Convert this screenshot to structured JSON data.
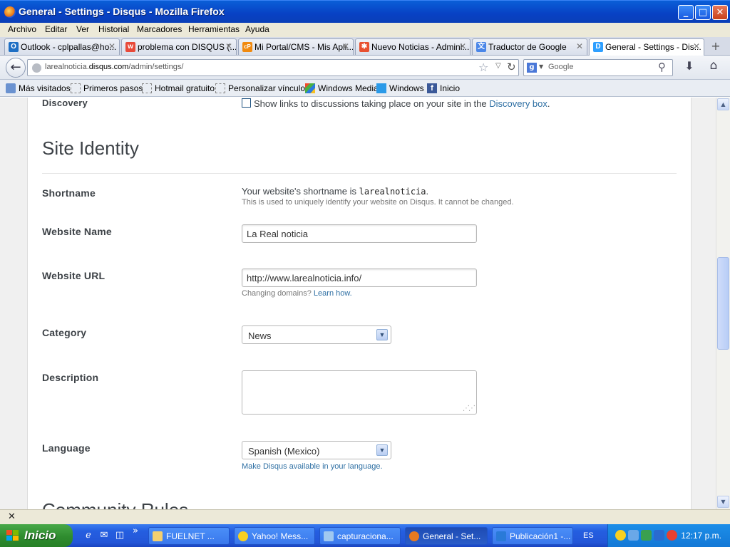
{
  "window": {
    "title": "General - Settings - Disqus - Mozilla Firefox",
    "minimize": "_",
    "maximize": "□",
    "close": "✕"
  },
  "menu": [
    "Archivo",
    "Editar",
    "Ver",
    "Historial",
    "Marcadores",
    "Herramientas",
    "Ayuda"
  ],
  "tabs": [
    {
      "label": "Outlook - cplpallas@ho...",
      "icon": "outlook-icon",
      "icon_color": "#1f6fc4",
      "icon_text": "O"
    },
    {
      "label": "problema con DISQUS (...",
      "icon": "blogger-icon",
      "icon_color": "#e84a3a",
      "icon_text": "w"
    },
    {
      "label": "Mi Portal/CMS - Mis Apli...",
      "icon": "cpanel-icon",
      "icon_color": "#f08a10",
      "icon_text": "cP"
    },
    {
      "label": "Nuevo Noticias - Admini...",
      "icon": "joomla-icon",
      "icon_color": "#e85030",
      "icon_text": "✱"
    },
    {
      "label": "Traductor de Google",
      "icon": "translate-icon",
      "icon_color": "#4a86e8",
      "icon_text": "文"
    },
    {
      "label": "General - Settings - Dis...",
      "icon": "disqus-icon",
      "icon_color": "#2e9fff",
      "icon_text": "D",
      "active": true
    }
  ],
  "tab_close": "✕",
  "new_tab": "+",
  "nav": {
    "url_host_pre": "larealnoticia.",
    "url_host": "disqus.com",
    "url_path": "/admin/settings/",
    "search_placeholder": "Google",
    "search_engine": "g"
  },
  "bookmarks": [
    {
      "label": "Más visitados",
      "icon": "most-visited-icon"
    },
    {
      "label": "Primeros pasos",
      "icon": "bookmark-page-icon"
    },
    {
      "label": "Hotmail gratuito",
      "icon": "bookmark-page-icon"
    },
    {
      "label": "Personalizar vínculos",
      "icon": "bookmark-page-icon"
    },
    {
      "label": "Windows Media",
      "icon": "windows-media-icon"
    },
    {
      "label": "Windows",
      "icon": "windows-icon"
    },
    {
      "label": "Inicio",
      "icon": "facebook-icon"
    }
  ],
  "content": {
    "discovery_label": "Discovery",
    "discovery_text": "Show links to discussions taking place on your site in the",
    "discovery_link": "Discovery box",
    "discovery_dot": ".",
    "section_title": "Site Identity",
    "shortname_label": "Shortname",
    "shortname_text": "Your website's shortname is",
    "shortname_value": "larealnoticia",
    "shortname_dot": ".",
    "shortname_help": "This is used to uniquely identify your website on Disqus. It cannot be changed.",
    "website_name_label": "Website Name",
    "website_name_value": "La Real noticia",
    "website_url_label": "Website URL",
    "website_url_value": "http://www.larealnoticia.info/",
    "url_help": "Changing domains?",
    "url_help_link": "Learn how.",
    "category_label": "Category",
    "category_value": "News",
    "description_label": "Description",
    "description_value": "",
    "language_label": "Language",
    "language_value": "Spanish (Mexico)",
    "language_link": "Make Disqus available in your language.",
    "next_section_partial": "Community Rules"
  },
  "taskbar": {
    "start_label": "Inicio",
    "quicklaunch_more": "»",
    "tasks": [
      {
        "label": "FUELNET      ...",
        "icon": "folder-icon",
        "icon_color": "#f4d070"
      },
      {
        "label": "Yahoo! Mess...",
        "icon": "yahoo-messenger-icon",
        "icon_color": "#f8d020"
      },
      {
        "label": "capturaciona...",
        "icon": "capture-icon",
        "icon_color": "#a0c8f0"
      },
      {
        "label": "General - Set...",
        "icon": "firefox-icon",
        "icon_color": "#e87a20",
        "active": true
      },
      {
        "label": "Publicación1 -...",
        "icon": "publisher-icon",
        "icon_color": "#2a7ad8"
      }
    ],
    "language": "ES",
    "clock": "12:17 p.m."
  },
  "colors": {
    "link": "#2e6fa3",
    "label": "#3d4247",
    "xp_blue": "#0a5fd8",
    "start_green": "#2f8c2f"
  }
}
